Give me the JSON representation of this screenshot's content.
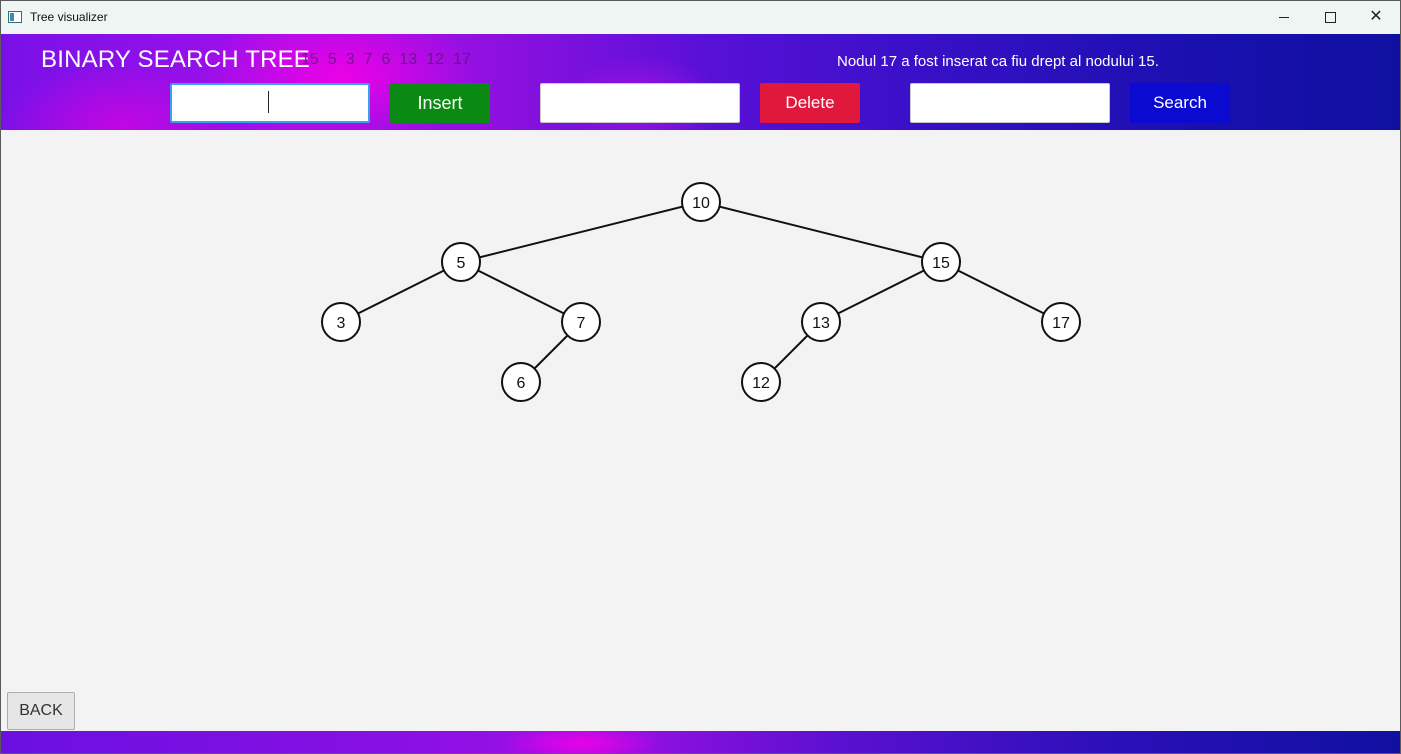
{
  "window": {
    "title": "Tree visualizer"
  },
  "header": {
    "title": "BINARY SEARCH TREE",
    "inserted_values": [
      "15",
      "5",
      "3",
      "7",
      "6",
      "13",
      "12",
      "17"
    ],
    "status_message": "Nodul 17 a fost inserat ca fiu drept al nodului 15."
  },
  "controls": {
    "insert_input": {
      "value": "",
      "placeholder": ""
    },
    "insert_label": "Insert",
    "delete_input": {
      "value": "",
      "placeholder": ""
    },
    "delete_label": "Delete",
    "search_input": {
      "value": "",
      "placeholder": ""
    },
    "search_label": "Search"
  },
  "colors": {
    "insert": "#0a8a12",
    "delete": "#e0183c",
    "search": "#0a0ad0"
  },
  "tree": {
    "nodes": [
      {
        "id": "10",
        "label": "10",
        "depth": 0,
        "inorder": 7
      },
      {
        "id": "5",
        "label": "5",
        "depth": 1,
        "inorder": 3
      },
      {
        "id": "15",
        "label": "15",
        "depth": 1,
        "inorder": 11
      },
      {
        "id": "3",
        "label": "3",
        "depth": 2,
        "inorder": 1
      },
      {
        "id": "7",
        "label": "7",
        "depth": 2,
        "inorder": 5
      },
      {
        "id": "13",
        "label": "13",
        "depth": 2,
        "inorder": 9
      },
      {
        "id": "17",
        "label": "17",
        "depth": 2,
        "inorder": 13
      },
      {
        "id": "6",
        "label": "6",
        "depth": 3,
        "inorder": 4
      },
      {
        "id": "12",
        "label": "12",
        "depth": 3,
        "inorder": 8
      }
    ],
    "edges": [
      [
        "10",
        "5"
      ],
      [
        "10",
        "15"
      ],
      [
        "5",
        "3"
      ],
      [
        "5",
        "7"
      ],
      [
        "7",
        "6"
      ],
      [
        "15",
        "13"
      ],
      [
        "15",
        "17"
      ],
      [
        "13",
        "12"
      ]
    ]
  },
  "footer": {
    "back_label": "BACK"
  }
}
